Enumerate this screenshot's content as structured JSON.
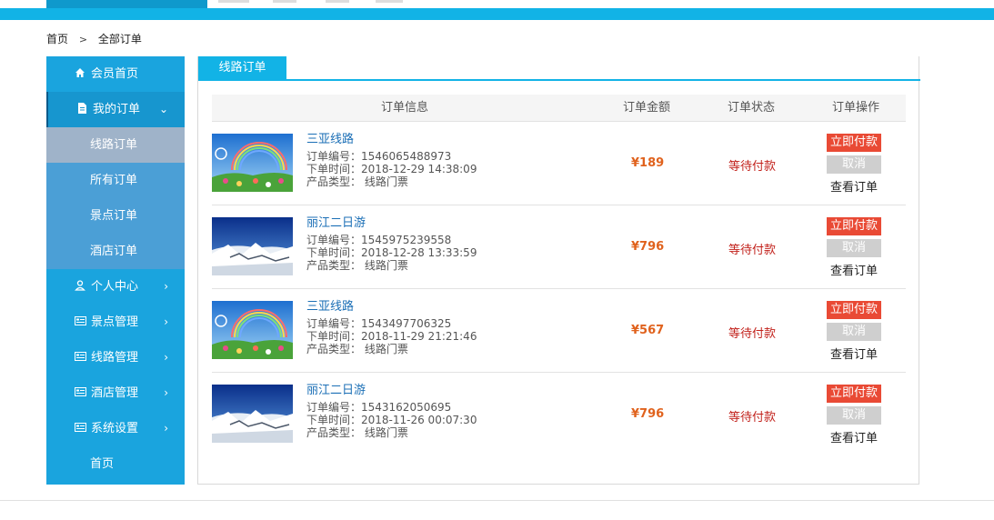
{
  "breadcrumb": {
    "home": "首页",
    "sep": ">",
    "current": "全部订单"
  },
  "sidebar": {
    "items": [
      {
        "label": "会员首页",
        "icon": "home-icon"
      },
      {
        "label": "我的订单",
        "icon": "document-icon",
        "arrow": "⌄"
      },
      {
        "label": "线路订单"
      },
      {
        "label": "所有订单"
      },
      {
        "label": "景点订单"
      },
      {
        "label": "酒店订单"
      },
      {
        "label": "个人中心",
        "icon": "user-icon",
        "arrow": "›"
      },
      {
        "label": "景点管理",
        "icon": "card-icon",
        "arrow": "›"
      },
      {
        "label": "线路管理",
        "icon": "card-icon",
        "arrow": "›"
      },
      {
        "label": "酒店管理",
        "icon": "card-icon",
        "arrow": "›"
      },
      {
        "label": "系统设置",
        "icon": "card-icon",
        "arrow": "›"
      },
      {
        "label": "首页"
      }
    ]
  },
  "tab": {
    "label": "线路订单"
  },
  "table": {
    "headers": [
      "订单信息",
      "订单金额",
      "订单状态",
      "订单操作"
    ],
    "rows": [
      {
        "name": "三亚线路",
        "order_no": "订单编号：1546065488973",
        "time": "下单时间：2018-12-29 14:38:09",
        "type": "产品类型： 线路门票",
        "amount": "¥189",
        "status": "等待付款",
        "thumb": "rainbow"
      },
      {
        "name": "丽江二日游",
        "order_no": "订单编号：1545975239558",
        "time": "下单时间：2018-12-28 13:33:59",
        "type": "产品类型： 线路门票",
        "amount": "¥796",
        "status": "等待付款",
        "thumb": "snow"
      },
      {
        "name": "三亚线路",
        "order_no": "订单编号：1543497706325",
        "time": "下单时间：2018-11-29 21:21:46",
        "type": "产品类型： 线路门票",
        "amount": "¥567",
        "status": "等待付款",
        "thumb": "rainbow"
      },
      {
        "name": "丽江二日游",
        "order_no": "订单编号：1543162050695",
        "time": "下单时间：2018-11-26 00:07:30",
        "type": "产品类型： 线路门票",
        "amount": "¥796",
        "status": "等待付款",
        "thumb": "snow"
      }
    ],
    "actions": {
      "pay": "立即付款",
      "cancel": "取消",
      "view": "查看订单"
    }
  },
  "colors": {
    "accent": "#12b3e6",
    "sidebar": "#1aa4de",
    "pay": "#e94a35",
    "status": "#c2221c",
    "amount": "#e0621d"
  }
}
